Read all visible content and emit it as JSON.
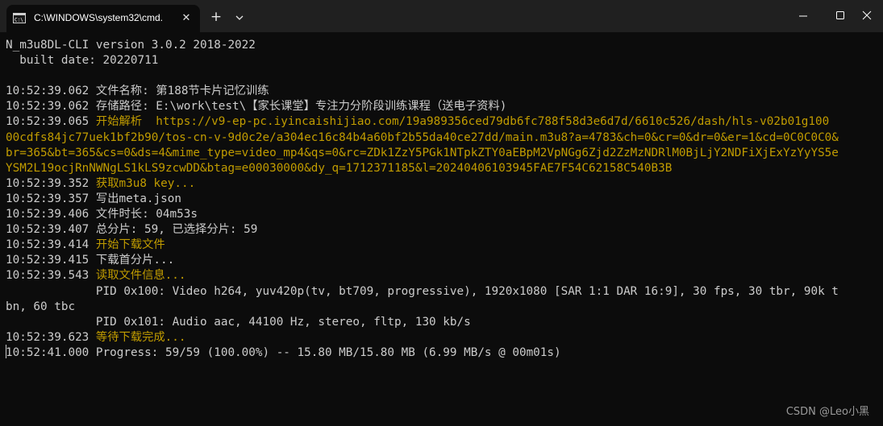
{
  "tab": {
    "title": "C:\\WINDOWS\\system32\\cmd.",
    "close_glyph": "✕",
    "new_tab_glyph": "+"
  },
  "colors": {
    "background": "#0c0c0c",
    "titlebar": "#202020",
    "text": "#cccccc",
    "highlight": "#c19c00"
  },
  "terminal": {
    "lines": [
      {
        "ts": "",
        "text": "N_m3u8DL-CLI version 3.0.2 2018-2022",
        "style": "wht"
      },
      {
        "ts": "",
        "text": "  built date: 20220711",
        "style": "wht"
      },
      {
        "ts": "",
        "text": "",
        "style": "wht"
      },
      {
        "ts": "10:52:39.062",
        "text": " 文件名称: 第188节卡片记忆训练",
        "style": "wht"
      },
      {
        "ts": "10:52:39.062",
        "text": " 存储路径: E:\\work\\test\\【家长课堂】专注力分阶段训练课程（送电子资料)",
        "style": "wht"
      },
      {
        "ts": "10:52:39.065",
        "text": " 开始解析  https://v9-ep-pc.iyincaishijiao.com/19a989356ced79db6fc788f58d3e6d7d/6610c526/dash/hls-v02b01g100",
        "style": "yel"
      },
      {
        "ts": "",
        "text": "00cdfs84jc77uek1bf2b90/tos-cn-v-9d0c2e/a304ec16c84b4a60bf2b55da40ce27dd/main.m3u8?a=4783&ch=0&cr=0&dr=0&er=1&cd=0C0C0C0&",
        "style": "yel"
      },
      {
        "ts": "",
        "text": "br=365&bt=365&cs=0&ds=4&mime_type=video_mp4&qs=0&rc=ZDk1ZzY5PGk1NTpkZTY0aEBpM2VpNGg6Zjd2ZzMzNDRlM0BjLjY2NDFiXjExYzYyYS5e",
        "style": "yel"
      },
      {
        "ts": "",
        "text": "YSM2L19ocjRnNWNgLS1kLS9zcwDD&btag=e00030000&dy_q=1712371185&l=20240406103945FAE7F54C62158C540B3B",
        "style": "yel"
      },
      {
        "ts": "10:52:39.352",
        "text": " 获取m3u8 key...",
        "style": "yel"
      },
      {
        "ts": "10:52:39.357",
        "text": " 写出meta.json",
        "style": "wht"
      },
      {
        "ts": "10:52:39.406",
        "text": " 文件时长: 04m53s",
        "style": "wht"
      },
      {
        "ts": "10:52:39.407",
        "text": " 总分片: 59, 已选择分片: 59",
        "style": "wht"
      },
      {
        "ts": "10:52:39.414",
        "text": " 开始下载文件",
        "style": "yel"
      },
      {
        "ts": "10:52:39.415",
        "text": " 下载首分片...",
        "style": "wht"
      },
      {
        "ts": "10:52:39.543",
        "text": " 读取文件信息...",
        "style": "yel"
      },
      {
        "ts": "",
        "text": "             PID 0x100: Video h264, yuv420p(tv, bt709, progressive), 1920x1080 [SAR 1:1 DAR 16:9], 30 fps, 30 tbr, 90k t",
        "style": "wht"
      },
      {
        "ts": "",
        "text": "bn, 60 tbc",
        "style": "wht"
      },
      {
        "ts": "",
        "text": "             PID 0x101: Audio aac, 44100 Hz, stereo, fltp, 130 kb/s",
        "style": "wht"
      },
      {
        "ts": "10:52:39.623",
        "text": " 等待下载完成...",
        "style": "yel"
      },
      {
        "ts": "10:52:41.000",
        "text": " Progress: 59/59 (100.00%) -- 15.80 MB/15.80 MB (6.99 MB/s @ 00m01s)",
        "style": "wht"
      }
    ]
  },
  "watermark": "CSDN @Leo小黑"
}
